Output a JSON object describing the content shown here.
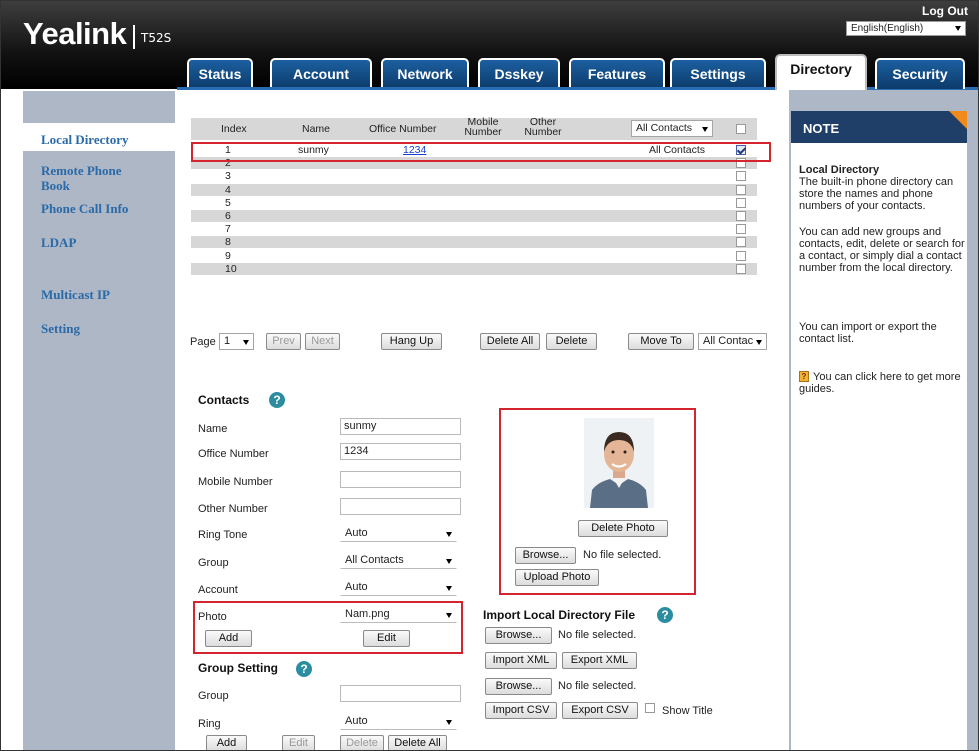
{
  "header": {
    "logo": "Yealink",
    "model": "T52S",
    "logout": "Log Out",
    "language": "English(English)"
  },
  "tabs": [
    {
      "label": "Status"
    },
    {
      "label": "Account"
    },
    {
      "label": "Network"
    },
    {
      "label": "Dsskey"
    },
    {
      "label": "Features"
    },
    {
      "label": "Settings"
    },
    {
      "label": "Directory",
      "active": true
    },
    {
      "label": "Security"
    }
  ],
  "sidebar": {
    "items": [
      {
        "label": "Local Directory",
        "active": true
      },
      {
        "label": "Remote Phone Book"
      },
      {
        "label": "Phone Call Info"
      },
      {
        "label": "LDAP"
      },
      {
        "label": "Multicast IP"
      },
      {
        "label": "Setting"
      }
    ]
  },
  "table": {
    "headers": {
      "index": "Index",
      "name": "Name",
      "office": "Office Number",
      "mobile": "Mobile Number",
      "other": "Other Number",
      "group_filter": "All Contacts"
    },
    "rows": [
      {
        "index": "1",
        "name": "sunmy",
        "office": "1234",
        "group": "All Contacts",
        "checked": true
      },
      {
        "index": "2"
      },
      {
        "index": "3"
      },
      {
        "index": "4"
      },
      {
        "index": "5"
      },
      {
        "index": "6"
      },
      {
        "index": "7"
      },
      {
        "index": "8"
      },
      {
        "index": "9"
      },
      {
        "index": "10"
      }
    ],
    "pager": {
      "page_label": "Page",
      "page": "1",
      "prev": "Prev",
      "next": "Next",
      "hang_up": "Hang Up",
      "delete_all": "Delete All",
      "delete": "Delete",
      "move_to": "Move To",
      "move_target": "All Contac"
    }
  },
  "contacts": {
    "title": "Contacts",
    "name_label": "Name",
    "name_value": "sunmy",
    "office_label": "Office Number",
    "office_value": "1234",
    "mobile_label": "Mobile Number",
    "mobile_value": "",
    "other_label": "Other Number",
    "other_value": "",
    "ring_label": "Ring Tone",
    "ring_value": "Auto",
    "group_label": "Group",
    "group_value": "All Contacts",
    "account_label": "Account",
    "account_value": "Auto",
    "photo_label": "Photo",
    "photo_value": "Nam.png",
    "add": "Add",
    "edit": "Edit"
  },
  "photo_panel": {
    "delete_photo": "Delete Photo",
    "browse": "Browse...",
    "no_file": "No file selected.",
    "upload": "Upload Photo"
  },
  "import": {
    "title": "Import Local Directory File",
    "browse": "Browse...",
    "no_file": "No file selected.",
    "import_xml": "Import XML",
    "export_xml": "Export XML",
    "browse2": "Browse...",
    "no_file2": "No file selected.",
    "import_csv": "Import CSV",
    "export_csv": "Export CSV",
    "show_title": "Show Title"
  },
  "group_setting": {
    "title": "Group Setting",
    "group_label": "Group",
    "group_value": "",
    "ring_label": "Ring",
    "ring_value": "Auto",
    "add": "Add",
    "edit": "Edit",
    "delete": "Delete",
    "delete_all": "Delete All"
  },
  "note": {
    "title": "NOTE",
    "heading": "Local Directory",
    "p1": "The built-in phone directory can store the names and phone numbers of your contacts.",
    "p2": "You can add new groups and contacts, edit, delete or search for a contact, or simply dial a contact number from the local directory.",
    "p3": "You can import or export the contact list.",
    "p4": "You can click here to get more guides."
  }
}
